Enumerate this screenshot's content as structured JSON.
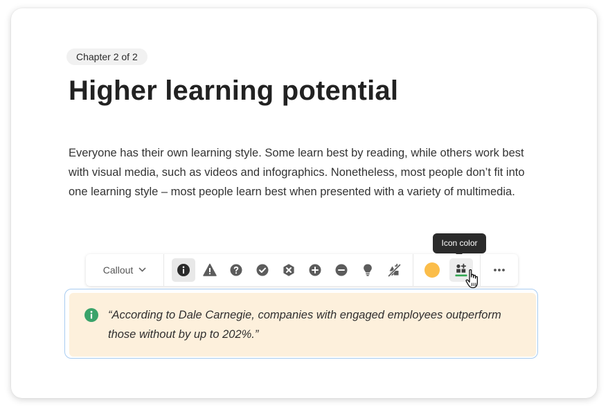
{
  "chapter_label": "Chapter 2 of 2",
  "title": "Higher learning potential",
  "body": "Everyone has their own learning style. Some learn best by reading, while others work best with visual media, such as videos and infographics. Nonetheless, most people don’t fit into one learning style – most people learn best when presented with a variety of multimedia.",
  "tooltip": "Icon color",
  "toolbar": {
    "type_label": "Callout",
    "icons": [
      "info-icon",
      "warning-icon",
      "question-icon",
      "check-icon",
      "close-circle-icon",
      "plus-circle-icon",
      "minus-circle-icon",
      "lightbulb-icon",
      "no-icon"
    ],
    "selected_icon": "info-icon",
    "swatch_color": "#fbbd4a",
    "icon_color_indicator": "#34a853"
  },
  "callout": {
    "icon": "info-icon",
    "icon_color": "#3aa36a",
    "text": "“According to Dale Carnegie, companies with engaged employees outperform those without by up to 202%.”",
    "background": "#fdf0dc"
  }
}
